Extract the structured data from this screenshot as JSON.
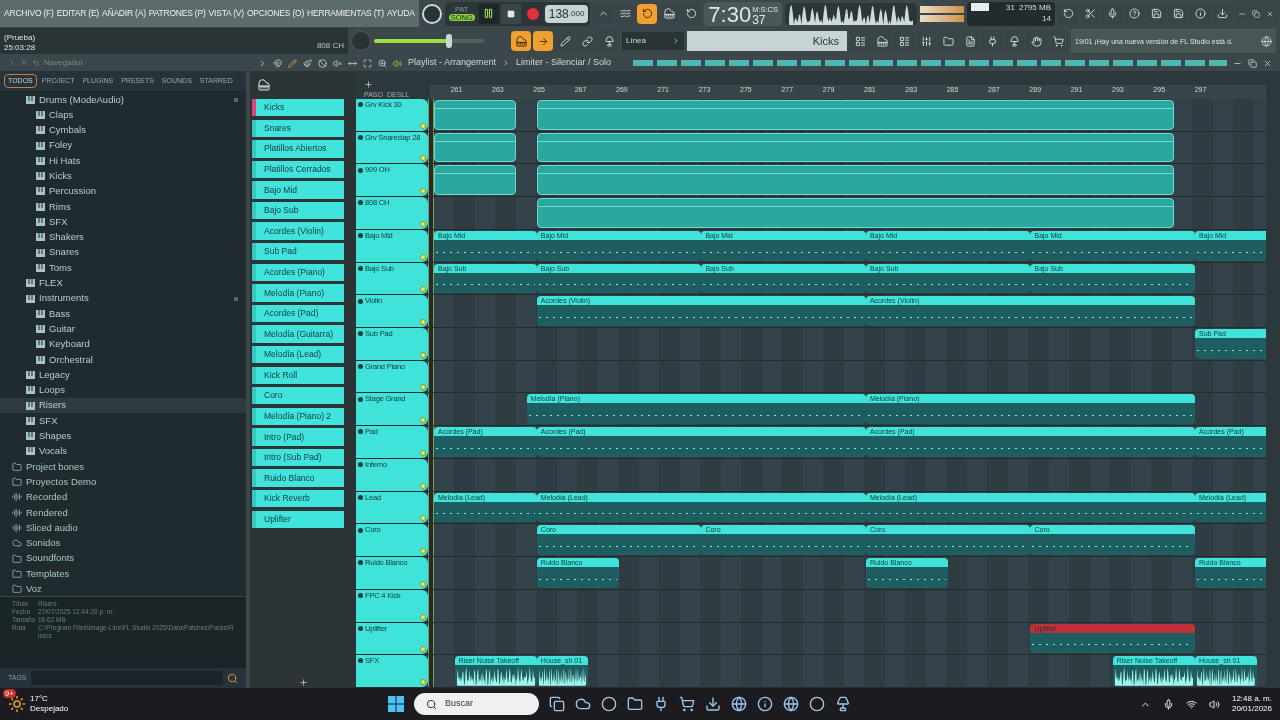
{
  "menu": [
    "ARCHIVO (F)",
    "EDITAR (E)",
    "AÑADIR (A)",
    "PATRONES (P)",
    "VISTA (V)",
    "OPCIONES (O)",
    "HERRAMIENTAS (T)",
    "AYUDA"
  ],
  "song_info": {
    "title": "(Prueba)",
    "time": "25:03:28",
    "channel": "808 CH"
  },
  "transport": {
    "mode_top": "PAT",
    "mode": "SONG",
    "song_mode": true,
    "playing": true,
    "tempo": "138",
    "tempo_decimals": ".000",
    "time": "7:30",
    "time_small": "37",
    "time_label": "M:S:CS",
    "snap": "Línea",
    "pattern": "Kicks"
  },
  "master_volume": {
    "level": 0.68
  },
  "monitor": {
    "cpu": "31",
    "memory": "2795 MB",
    "polyphony": "14"
  },
  "news": {
    "date": "19/01",
    "text": "¡Hay una nueva versión de FL Studio está d."
  },
  "browser": {
    "title": "Navegador",
    "tabs": [
      {
        "label": "TODOS",
        "selected": true
      },
      {
        "label": "PROJECT",
        "selected": false
      },
      {
        "label": "PLUGINS",
        "selected": false
      },
      {
        "label": "PRESETS",
        "selected": false
      },
      {
        "label": "SOUNDS",
        "selected": false
      },
      {
        "label": "STARRED",
        "selected": false
      }
    ],
    "tree": [
      {
        "label": "Drums (ModeAudio)",
        "kind": "pack",
        "selected": false,
        "expanded": true,
        "children": [
          {
            "label": "Claps",
            "kind": "pack",
            "selected": false
          },
          {
            "label": "Cymbals",
            "kind": "pack",
            "selected": false
          },
          {
            "label": "Foley",
            "kind": "pack",
            "selected": false
          },
          {
            "label": "Hi Hats",
            "kind": "pack",
            "selected": false
          },
          {
            "label": "Kicks",
            "kind": "pack",
            "selected": false
          },
          {
            "label": "Percussion",
            "kind": "pack",
            "selected": false
          },
          {
            "label": "Rims",
            "kind": "pack",
            "selected": false
          },
          {
            "label": "SFX",
            "kind": "pack",
            "selected": false
          },
          {
            "label": "Shakers",
            "kind": "pack",
            "selected": false
          },
          {
            "label": "Snares",
            "kind": "pack",
            "selected": false
          },
          {
            "label": "Toms",
            "kind": "pack",
            "selected": false
          }
        ]
      },
      {
        "label": "FLEX",
        "kind": "pack",
        "selected": false
      },
      {
        "label": "Instruments",
        "kind": "pack",
        "selected": false,
        "expanded": true,
        "children": [
          {
            "label": "Bass",
            "kind": "pack",
            "selected": false
          },
          {
            "label": "Guitar",
            "kind": "pack",
            "selected": false
          },
          {
            "label": "Keyboard",
            "kind": "pack",
            "selected": false
          },
          {
            "label": "Orchestral",
            "kind": "pack",
            "selected": false
          }
        ]
      },
      {
        "label": "Legacy",
        "kind": "pack",
        "selected": false
      },
      {
        "label": "Loops",
        "kind": "pack",
        "selected": false
      },
      {
        "label": "Risers",
        "kind": "pack",
        "selected": true
      },
      {
        "label": "SFX",
        "kind": "pack",
        "selected": false
      },
      {
        "label": "Shapes",
        "kind": "pack",
        "selected": false
      },
      {
        "label": "Vocals",
        "kind": "pack",
        "selected": false
      }
    ],
    "folders": [
      {
        "label": "Project bones",
        "kind": "folder"
      },
      {
        "label": "Proyectos Demo",
        "kind": "folder"
      },
      {
        "label": "Recorded",
        "kind": "audio"
      },
      {
        "label": "Rendered",
        "kind": "audio"
      },
      {
        "label": "Sliced audio",
        "kind": "audio"
      },
      {
        "label": "Sonidos",
        "kind": "cloud"
      },
      {
        "label": "Soundfonts",
        "kind": "folder"
      },
      {
        "label": "Templates",
        "kind": "folder"
      },
      {
        "label": "Voz",
        "kind": "folder"
      }
    ],
    "info": [
      {
        "label": "Título",
        "value": "Risers"
      },
      {
        "label": "Fecha",
        "value": "27/07/2025 12:44:20 p. m."
      },
      {
        "label": "Tamaño",
        "value": "16.62 MB"
      },
      {
        "label": "Ruta",
        "value": "C:\\Program Files\\Image-Line\\FL Studio 2025\\Data\\Patches\\Packs\\Risers"
      }
    ],
    "tags_label": "TAGS"
  },
  "playlist": {
    "title": "Playlist - Arrangement",
    "breadcrumb": "Limiter - Silenciar / Solo",
    "step_label": "PASO",
    "slide_label": "DESLL",
    "patterns": [
      {
        "name": "Kicks",
        "selected": true
      },
      {
        "name": "Snares",
        "selected": false
      },
      {
        "name": "Platillos Abiertos",
        "selected": false
      },
      {
        "name": "Platillos Cerrados",
        "selected": false
      },
      {
        "name": "Bajo Mid",
        "selected": false
      },
      {
        "name": "Bajo Sub",
        "selected": false
      },
      {
        "name": "Acordes (Violin)",
        "selected": false
      },
      {
        "name": "Sub Pad",
        "selected": false
      },
      {
        "name": "Acordes (Piano)",
        "selected": false
      },
      {
        "name": "Melodía (Piano)",
        "selected": false
      },
      {
        "name": "Acordes (Pad)",
        "selected": false
      },
      {
        "name": "Melodía (Guitarra)",
        "selected": false
      },
      {
        "name": "Melodía (Lead)",
        "selected": false
      },
      {
        "name": "Kick Roll",
        "selected": false
      },
      {
        "name": "Coro",
        "selected": false
      },
      {
        "name": "Melodía (Piano) 2",
        "selected": false
      },
      {
        "name": "Intro (Pad)",
        "selected": false
      },
      {
        "name": "Intro (Sub Pad)",
        "selected": false
      },
      {
        "name": "Ruido Blanco",
        "selected": false
      },
      {
        "name": "Kick Reverb",
        "selected": false
      },
      {
        "name": "Uplifter",
        "selected": false
      }
    ],
    "bars": [
      "261",
      "263",
      "265",
      "267",
      "269",
      "271",
      "273",
      "275",
      "277",
      "279",
      "281",
      "283",
      "285",
      "287",
      "289",
      "291",
      "293",
      "295",
      "297"
    ],
    "tracks": [
      {
        "name": "Grv Kick 30",
        "clips": [
          {
            "kind": "block",
            "color": "#2aa89f"
          },
          {
            "kind": "block",
            "color": "#2aa89f"
          }
        ]
      },
      {
        "name": "Grv Snareclap 28",
        "clips": [
          {
            "kind": "block",
            "color": "#2aa89f"
          },
          {
            "kind": "block",
            "color": "#2aa89f"
          }
        ]
      },
      {
        "name": "909 OH",
        "clips": [
          {
            "kind": "block",
            "color": "#2aa89f"
          },
          {
            "kind": "block",
            "color": "#2aa89f"
          }
        ]
      },
      {
        "name": "808 CH",
        "clips": [
          {
            "kind": "block",
            "color": "#2aa89f"
          }
        ]
      },
      {
        "name": "Bajo Mid",
        "clips": [
          {
            "kind": "pattern",
            "label": "Bajo Mid",
            "color": "#3fe3da"
          },
          {
            "kind": "pattern",
            "label": "Bajo Mid",
            "color": "#3fe3da"
          },
          {
            "kind": "pattern",
            "label": "Bajo Mid",
            "color": "#3fe3da"
          },
          {
            "kind": "pattern",
            "label": "Bajo Mid",
            "color": "#3fe3da"
          },
          {
            "kind": "pattern",
            "label": "Bajo Mid",
            "color": "#3fe3da"
          },
          {
            "kind": "pattern",
            "label": "Bajo Mid",
            "color": "#3fe3da"
          }
        ]
      },
      {
        "name": "Bajo Sub",
        "clips": [
          {
            "kind": "pattern",
            "label": "Bajo Sub",
            "color": "#3fe3da"
          },
          {
            "kind": "pattern",
            "label": "Bajo Sub",
            "color": "#3fe3da"
          },
          {
            "kind": "pattern",
            "label": "Bajo Sub",
            "color": "#3fe3da"
          },
          {
            "kind": "pattern",
            "label": "Bajo Sub",
            "color": "#3fe3da"
          },
          {
            "kind": "pattern",
            "label": "Bajo Sub",
            "color": "#3fe3da"
          }
        ]
      },
      {
        "name": "Violin",
        "clips": [
          {
            "kind": "pattern",
            "label": "Acordes (Violin)",
            "color": "#3fe3da"
          },
          {
            "kind": "pattern",
            "label": "Acordes (Violin)",
            "color": "#3fe3da"
          }
        ]
      },
      {
        "name": "Sub Pad",
        "clips": [
          {
            "kind": "pattern",
            "label": "Sub Pad",
            "color": "#3fe3da"
          }
        ]
      },
      {
        "name": "Grand Piano"
      },
      {
        "name": "Stage Grand",
        "clips": [
          {
            "kind": "pattern",
            "label": "Melodía (Piano)",
            "color": "#3fe3da"
          },
          {
            "kind": "pattern",
            "label": "Melodía (Piano)",
            "color": "#3fe3da"
          }
        ]
      },
      {
        "name": "Pad",
        "clips": [
          {
            "kind": "pattern",
            "label": "Acordes (Pad)",
            "color": "#3fe3da"
          },
          {
            "kind": "pattern",
            "label": "Acordes (Pad)",
            "color": "#3fe3da"
          },
          {
            "kind": "pattern",
            "label": "Acordes (Pad)",
            "color": "#3fe3da"
          },
          {
            "kind": "pattern",
            "label": "Acordes (Pad)",
            "color": "#3fe3da"
          }
        ]
      },
      {
        "name": "Inferno"
      },
      {
        "name": "Lead",
        "clips": [
          {
            "kind": "pattern",
            "label": "Melodía (Lead)",
            "color": "#3fe3da"
          },
          {
            "kind": "pattern",
            "label": "Melodía (Lead)",
            "color": "#3fe3da"
          },
          {
            "kind": "pattern",
            "label": "Melodía (Lead)",
            "color": "#3fe3da"
          },
          {
            "kind": "pattern",
            "label": "Melodía (Lead)",
            "color": "#3fe3da"
          }
        ]
      },
      {
        "name": "Coro",
        "clips": [
          {
            "kind": "pattern",
            "label": "Coro",
            "color": "#3fe3da"
          },
          {
            "kind": "pattern",
            "label": "Coro",
            "color": "#3fe3da"
          },
          {
            "kind": "pattern",
            "label": "Coro",
            "color": "#3fe3da"
          },
          {
            "kind": "pattern",
            "label": "Coro",
            "color": "#3fe3da"
          }
        ]
      },
      {
        "name": "Ruido Blanco",
        "clips": [
          {
            "kind": "pattern",
            "label": "Ruido Blanco",
            "color": "#3fe3da"
          },
          {
            "kind": "pattern",
            "label": "Ruido Blanco",
            "color": "#3fe3da"
          },
          {
            "kind": "pattern",
            "label": "Ruido Blanco",
            "color": "#3fe3da"
          }
        ]
      },
      {
        "name": "FPC 4 Kick"
      },
      {
        "name": "Uplifter",
        "clips": [
          {
            "kind": "pattern",
            "label": "Uplifter",
            "color": "#c0303a"
          }
        ]
      },
      {
        "name": "SFX",
        "clips": [
          {
            "kind": "audio",
            "label": "Riser Noise Takeoff",
            "color": "#3fe3da"
          },
          {
            "kind": "audio",
            "label": "House_sh 01",
            "color": "#3fe3da"
          },
          {
            "kind": "audio",
            "label": "Riser Noise Takeoff",
            "color": "#3fe3da"
          },
          {
            "kind": "audio",
            "label": "House_sh 01",
            "color": "#3fe3da"
          }
        ]
      }
    ]
  },
  "taskbar": {
    "temperature": "17°C",
    "weather": "Despejado",
    "badge": "9+",
    "search_placeholder": "Buscar",
    "time": "12:48 a. m.",
    "date": "20/01/2026"
  }
}
